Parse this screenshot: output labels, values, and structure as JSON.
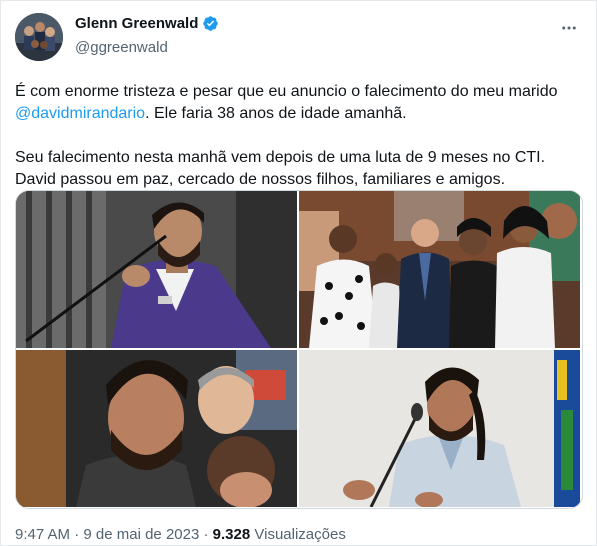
{
  "author": {
    "name": "Glenn Greenwald",
    "handle": "@ggreenwald",
    "verified": true
  },
  "tweet": {
    "p1_before": "É com enorme tristeza e pesar que eu anuncio o falecimento do meu marido ",
    "mention": "@davidmirandario",
    "p1_after": ". Ele faria 38 anos de idade amanhã.",
    "p2": "Seu falecimento nesta manhã vem depois de uma luta de 9 meses no CTI. David passou em paz, cercado de nossos filhos, familiares e amigos."
  },
  "meta": {
    "time": "9:47 AM",
    "date": "9 de mai de 2023",
    "views_count": "9.328",
    "views_label": "Visualizações",
    "separator": "·"
  },
  "colors": {
    "accent": "#1d9bf0",
    "secondary_text": "#536471",
    "primary_text": "#0f1419"
  },
  "icons": {
    "verified": "verified-badge-icon",
    "more": "more-options-icon"
  }
}
